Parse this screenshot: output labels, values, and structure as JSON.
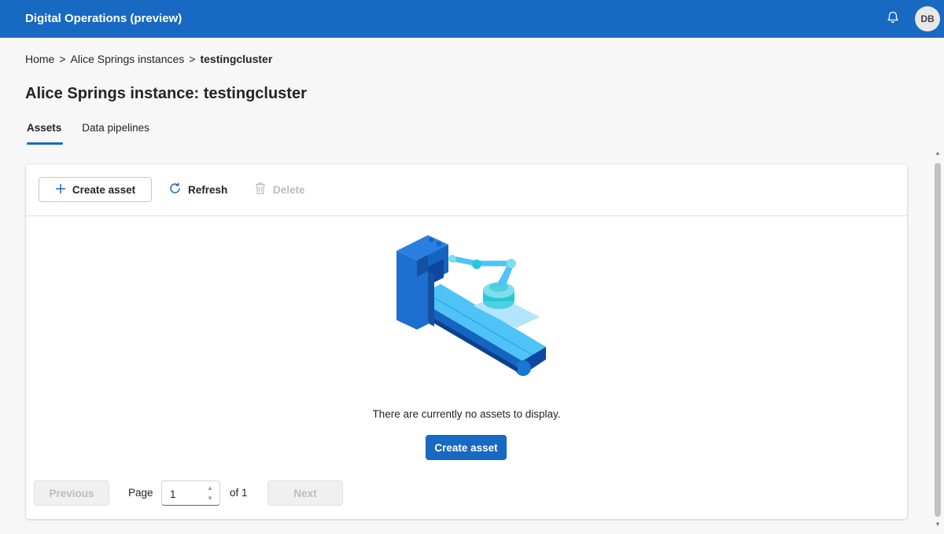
{
  "header": {
    "app_title": "Digital Operations (preview)",
    "avatar_initials": "DB",
    "brand_color": "#1769c2"
  },
  "breadcrumb": {
    "home": "Home",
    "separator": ">",
    "instances": "Alice Springs instances",
    "current": "testingcluster"
  },
  "page": {
    "title": "Alice Springs instance: testingcluster"
  },
  "tabs": [
    {
      "label": "Assets",
      "active": true
    },
    {
      "label": "Data pipelines",
      "active": false
    }
  ],
  "toolbar": {
    "create_label": "Create asset",
    "refresh_label": "Refresh",
    "delete_label": "Delete"
  },
  "empty_state": {
    "message": "There are currently no assets to display.",
    "button_label": "Create asset",
    "illustration": "robot-arm-conveyor-icon"
  },
  "pagination": {
    "previous_label": "Previous",
    "page_label": "Page",
    "current_page": "1",
    "of_label": "of 1",
    "next_label": "Next"
  }
}
